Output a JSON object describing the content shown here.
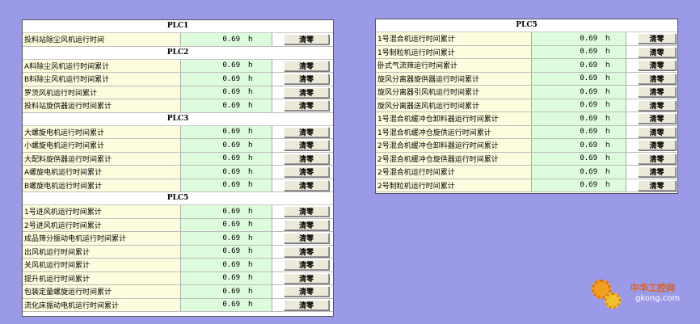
{
  "left_panel": {
    "sections": [
      {
        "title": "PLC1",
        "rows": [
          {
            "label": "投料站除尘风机运行时间",
            "value": "0.69",
            "unit": "h",
            "button": "清零"
          }
        ]
      },
      {
        "title": "PLC2",
        "rows": [
          {
            "label": "A料除尘风机运行时间累计",
            "value": "0.69",
            "unit": "h",
            "button": "清零"
          },
          {
            "label": "B料除尘风机运行时间累计",
            "value": "0.69",
            "unit": "h",
            "button": "清零"
          },
          {
            "label": "罗茨风机运行时间累计",
            "value": "0.69",
            "unit": "h",
            "button": "清零"
          },
          {
            "label": "投料站旋供器运行时间累计",
            "value": "0.69",
            "unit": "h",
            "button": "清零"
          }
        ]
      },
      {
        "title": "PLC3",
        "rows": [
          {
            "label": "大螺旋电机运行时间累计",
            "value": "0.69",
            "unit": "h",
            "button": "清零"
          },
          {
            "label": "小螺旋电机运行时间累计",
            "value": "0.69",
            "unit": "h",
            "button": "清零"
          },
          {
            "label": "大配料旋供器运行时间累计",
            "value": "0.69",
            "unit": "h",
            "button": "清零"
          },
          {
            "label": "A螺旋电机运行时间累计",
            "value": "0.69",
            "unit": "h",
            "button": "清零"
          },
          {
            "label": "B螺旋电机运行时间累计",
            "value": "0.69",
            "unit": "h",
            "button": "清零"
          }
        ]
      },
      {
        "title": "PLC5",
        "rows": [
          {
            "label": "1号进风机运行时间累计",
            "value": "0.69",
            "unit": "h",
            "button": "清零"
          },
          {
            "label": "2号进风机运行时间累计",
            "value": "0.69",
            "unit": "h",
            "button": "清零"
          },
          {
            "label": "成品筛分振动电机运行时间累计",
            "value": "0.69",
            "unit": "h",
            "button": "清零"
          },
          {
            "label": "出风机运行时间累计",
            "value": "0.69",
            "unit": "h",
            "button": "清零"
          },
          {
            "label": "关风机运行时间累计",
            "value": "0.69",
            "unit": "h",
            "button": "清零"
          },
          {
            "label": "提升机运行时间累计",
            "value": "0.69",
            "unit": "h",
            "button": "清零"
          },
          {
            "label": "包装定量螺旋运行时间累计",
            "value": "0.69",
            "unit": "h",
            "button": "清零"
          },
          {
            "label": "流化床振动电机运行时间累计",
            "value": "0.69",
            "unit": "h",
            "button": "清零"
          }
        ]
      }
    ]
  },
  "right_panel": {
    "sections": [
      {
        "title": "PLC5",
        "rows": [
          {
            "label": "1号混合机运行时间累计",
            "value": "0.69",
            "unit": "h",
            "button": "清零"
          },
          {
            "label": "1号制粒机运行时间累计",
            "value": "0.69",
            "unit": "h",
            "button": "清零"
          },
          {
            "label": "卧式气流筛运行时间累计",
            "value": "0.69",
            "unit": "h",
            "button": "清零"
          },
          {
            "label": "旋风分离器旋供器运行时间累计",
            "value": "0.69",
            "unit": "h",
            "button": "清零"
          },
          {
            "label": "旋风分离器引风机运行时间累计",
            "value": "0.69",
            "unit": "h",
            "button": "清零"
          },
          {
            "label": "旋风分离器送风机运行时间累计",
            "value": "0.69",
            "unit": "h",
            "button": "清零"
          },
          {
            "label": "1号混合机缓冲仓卸料器运行时间累计",
            "value": "0.69",
            "unit": "h",
            "button": "清零"
          },
          {
            "label": "1号混合机缓冲仓旋供运行时间累计",
            "value": "0.69",
            "unit": "h",
            "button": "清零"
          },
          {
            "label": "2号混合机缓冲仓卸料器运行时间累计",
            "value": "0.69",
            "unit": "h",
            "button": "清零"
          },
          {
            "label": "2号混合机缓冲仓旋供器运行时间累计",
            "value": "0.69",
            "unit": "h",
            "button": "清零"
          },
          {
            "label": "2号混合机运行时间累计",
            "value": "0.69",
            "unit": "h",
            "button": "清零"
          },
          {
            "label": "2号制粒机运行时间累计",
            "value": "0.69",
            "unit": "h",
            "button": "清零"
          }
        ]
      }
    ]
  },
  "watermark": {
    "cn": "中华工控网",
    "en": "gkong.com",
    "icon": "gear-icon"
  },
  "colors": {
    "background": "#9a9ae8",
    "label_bg": "#fdfcdc",
    "value_bg": "#ddfbdd",
    "button_bg": "#ece9d8"
  }
}
